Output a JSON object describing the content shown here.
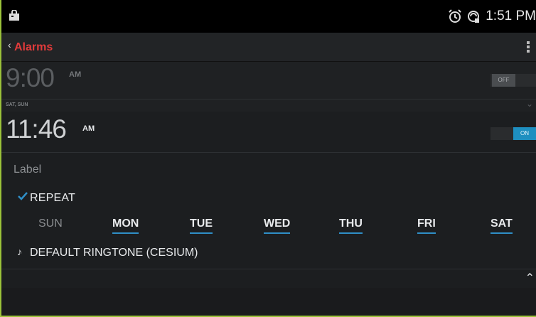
{
  "statusbar": {
    "time": "1:51 PM",
    "icons": [
      "shopping-bag-icon",
      "alarm-clock-icon",
      "sync-icon"
    ]
  },
  "actionbar": {
    "title": "Alarms",
    "back_icon": "chevron-left-icon",
    "menu_icon": "overflow-menu-icon"
  },
  "alarms": [
    {
      "time": "9:00",
      "ampm": "AM",
      "days": "SAT, SUN",
      "toggle_label": "OFF",
      "expanded": false
    },
    {
      "time": "11:46",
      "ampm": "AM",
      "toggle_label": "ON",
      "expanded": true,
      "label_placeholder": "Label",
      "repeat_label": "REPEAT",
      "repeat_checked": true,
      "days": [
        {
          "label": "SUN",
          "active": false
        },
        {
          "label": "MON",
          "active": true
        },
        {
          "label": "TUE",
          "active": true
        },
        {
          "label": "WED",
          "active": true
        },
        {
          "label": "THU",
          "active": true
        },
        {
          "label": "FRI",
          "active": true
        },
        {
          "label": "SAT",
          "active": true
        }
      ],
      "ringtone_label": "DEFAULT RINGTONE (CESIUM)"
    }
  ],
  "colors": {
    "accent": "#2f8fc7",
    "title": "#e23b3b",
    "background": "#1c1e20",
    "frame": "#9bc23a"
  }
}
